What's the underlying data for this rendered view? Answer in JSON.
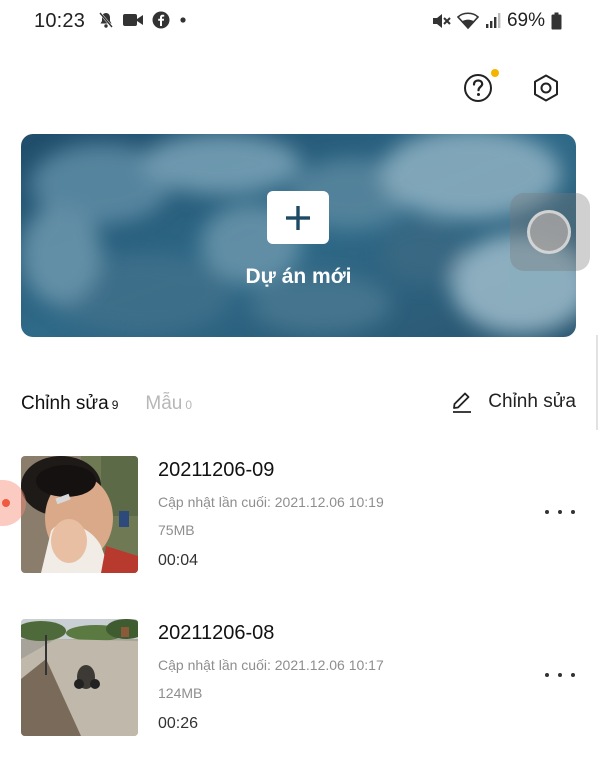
{
  "status_bar": {
    "time": "10:23",
    "battery": "69%"
  },
  "banner": {
    "label": "Dự án mới"
  },
  "tabs": {
    "edit_label": "Chỉnh sửa",
    "edit_count": "9",
    "templates_label": "Mẫu",
    "templates_count": "0"
  },
  "edit_action": {
    "label": "Chỉnh sửa"
  },
  "projects": [
    {
      "title": "20211206-09",
      "updated": "Cập nhật lần cuối: 2021.12.06 10:19",
      "size": "75MB",
      "duration": "00:04"
    },
    {
      "title": "20211206-08",
      "updated": "Cập nhật lần cuối: 2021.12.06 10:17",
      "size": "124MB",
      "duration": "00:26"
    }
  ],
  "colors": {
    "accent_dot": "#f5b400",
    "banner_blue": "#2a5a78"
  }
}
